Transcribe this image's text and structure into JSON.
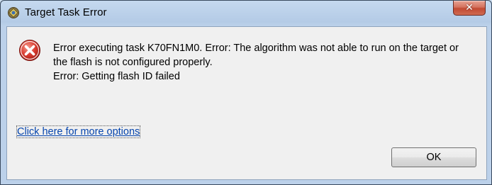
{
  "window": {
    "title": "Target Task Error",
    "close_glyph": "✕"
  },
  "message": {
    "lines": [
      "Error executing task K70FN1M0. Error:  The algorithm was not able to run on the target or",
      "the flash is not configured properly.",
      "Error:  Getting flash ID failed"
    ]
  },
  "link_text": "Click here for more options",
  "ok_label": "OK",
  "icons": {
    "app": "cw-app-icon",
    "error": "error-icon"
  },
  "colors": {
    "error_red": "#d83a2e",
    "link_blue": "#0645ad",
    "close_red": "#c24a33"
  }
}
